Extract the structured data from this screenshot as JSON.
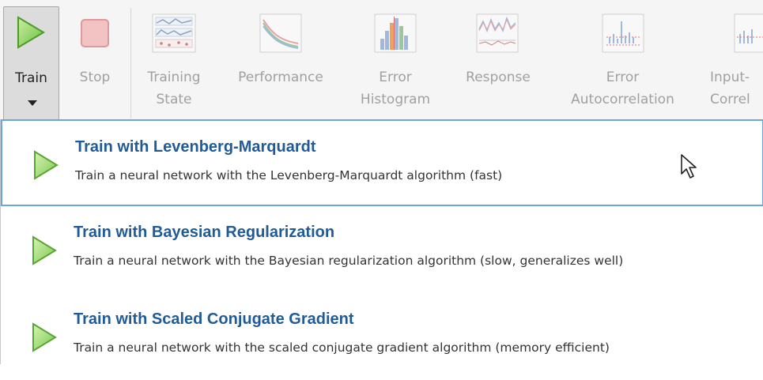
{
  "toolbar": {
    "train_label": "Train",
    "stop_label": "Stop",
    "training_state_label": [
      "Training",
      "State"
    ],
    "performance_label": "Performance",
    "error_histogram_label": [
      "Error",
      "Histogram"
    ],
    "response_label": "Response",
    "error_autocorrelation_label": [
      "Error",
      "Autocorrelation"
    ],
    "input_error_correlation_label": [
      "Input-",
      "Correl"
    ]
  },
  "menu": {
    "items": [
      {
        "title": "Train with Levenberg-Marquardt",
        "description": "Train a neural network with the Levenberg-Marquardt algorithm (fast)",
        "icon": "play-icon"
      },
      {
        "title": "Train with Bayesian Regularization",
        "description": "Train a neural network with the Bayesian regularization algorithm (slow, generalizes well)",
        "icon": "play-icon"
      },
      {
        "title": "Train with Scaled Conjugate Gradient",
        "description": "Train a neural network with the scaled conjugate gradient algorithm (memory efficient)",
        "icon": "play-icon"
      }
    ]
  },
  "colors": {
    "accent": "#1f5b98",
    "play_green": "#8fd26a",
    "hover_border": "#6aa6de"
  }
}
